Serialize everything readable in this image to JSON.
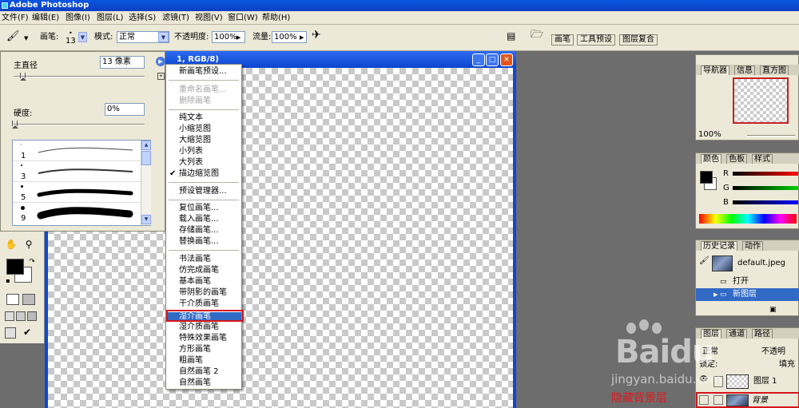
{
  "app": {
    "title": "Adobe Photoshop"
  },
  "menubar": [
    "文件(F)",
    "编辑(E)",
    "图像(I)",
    "图层(L)",
    "选择(S)",
    "滤镜(T)",
    "视图(V)",
    "窗口(W)",
    "帮助(H)"
  ],
  "options": {
    "brush_label": "画笔:",
    "brush_size": "13",
    "mode_label": "模式:",
    "mode_value": "正常",
    "opacity_label": "不透明度:",
    "opacity_value": "100%",
    "flow_label": "流量:",
    "flow_value": "100%",
    "well_tabs": [
      "画笔",
      "工具预设",
      "图层复合"
    ]
  },
  "document": {
    "title": "1, RGB/8)"
  },
  "brush_panel": {
    "diameter_label": "主直径",
    "diameter_value": "13 像素",
    "hardness_label": "硬度:",
    "hardness_value": "0%",
    "presets": [
      {
        "number": "1",
        "dot_size": 1
      },
      {
        "number": "3",
        "dot_size": 2
      },
      {
        "number": "5",
        "dot_size": 3
      },
      {
        "number": "9",
        "dot_size": 5
      }
    ]
  },
  "brush_menu": {
    "new_preset": "新画笔预设...",
    "rename": "重命名画笔...",
    "delete": "删除画笔",
    "view_modes": [
      "纯文本",
      "小缩览图",
      "大缩览图",
      "小列表",
      "大列表",
      "描边缩览图"
    ],
    "checked_view": "描边缩览图",
    "preset_manager": "预设管理器...",
    "file_ops": [
      "复位画笔...",
      "载入画笔...",
      "存储画笔...",
      "替换画笔..."
    ],
    "libraries": [
      "书法画笔",
      "仿完成画笔",
      "基本画笔",
      "带阴影的画笔",
      "干介质画笔",
      "湿介画笔",
      "湿介质画笔",
      "特殊效果画笔",
      "方形画笔",
      "粗画笔",
      "自然画笔 2",
      "自然画笔"
    ],
    "highlighted": "湿介画笔"
  },
  "panels": {
    "navigator": {
      "tabs": [
        "导航器",
        "信息",
        "直方图"
      ],
      "zoom": "100%"
    },
    "color": {
      "tabs": [
        "颜色",
        "色板",
        "样式"
      ],
      "channels": [
        "R",
        "G",
        "B"
      ]
    },
    "history": {
      "tabs": [
        "历史记录",
        "动作"
      ],
      "snapshot": "default.jpeg",
      "steps": [
        "打开",
        "新图层"
      ],
      "active_step": "新图层"
    },
    "layers": {
      "tabs": [
        "图层",
        "通道",
        "路径"
      ],
      "blend_mode": "正常",
      "opacity_label": "不透明",
      "lock_label": "锁定:",
      "fill_label": "填充",
      "layers": [
        {
          "name": "图层 1",
          "visible": true
        },
        {
          "name": "背景",
          "visible": false
        }
      ]
    }
  },
  "watermark": {
    "brand": "Baidu",
    "site": "jingyan.baidu.com",
    "caption": "隐藏背景层"
  },
  "colors": {
    "accent_blue": "#316ac5",
    "highlight_red": "#d6161c"
  }
}
